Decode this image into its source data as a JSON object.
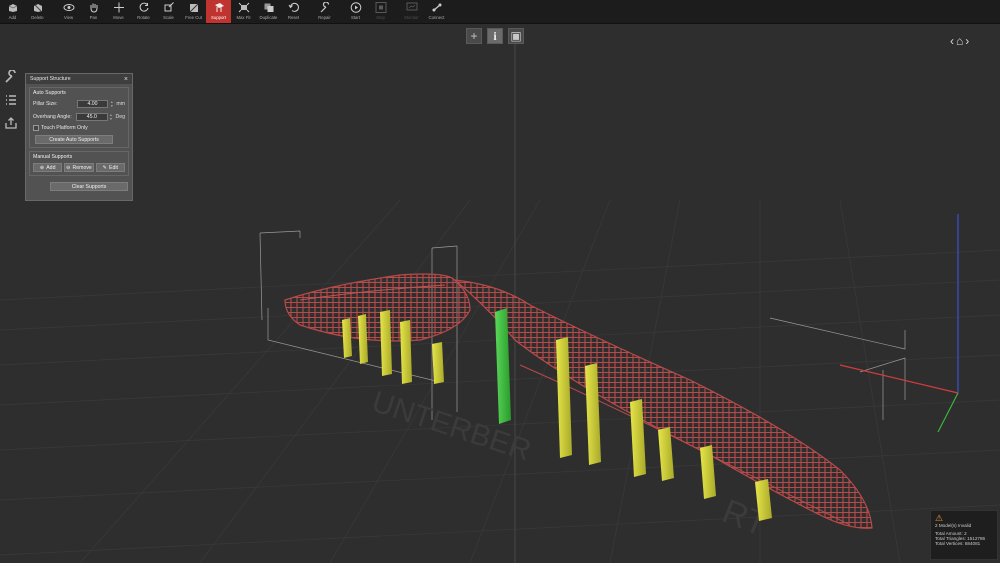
{
  "toolbar": {
    "items": [
      {
        "label": "Add",
        "icon": "add-model-icon"
      },
      {
        "label": "Delete",
        "icon": "delete-icon"
      },
      {
        "label": "View",
        "icon": "eye-icon"
      },
      {
        "label": "Pan",
        "icon": "hand-icon"
      },
      {
        "label": "Move",
        "icon": "move-icon"
      },
      {
        "label": "Rotate",
        "icon": "rotate-icon"
      },
      {
        "label": "Scale",
        "icon": "scale-icon"
      },
      {
        "label": "Free Cut",
        "icon": "free-cut-icon"
      },
      {
        "label": "Support",
        "icon": "support-icon",
        "active": true
      },
      {
        "label": "Max Fit",
        "icon": "max-fit-icon"
      },
      {
        "label": "Duplicate",
        "icon": "duplicate-icon"
      },
      {
        "label": "Reset",
        "icon": "reset-icon"
      },
      {
        "label": "Repair",
        "icon": "wrench-icon"
      },
      {
        "label": "Start",
        "icon": "play-icon"
      },
      {
        "label": "Stop",
        "icon": "stop-icon",
        "disabled": true
      },
      {
        "label": "Monitor",
        "icon": "monitor-icon",
        "disabled": true
      },
      {
        "label": "Connect",
        "icon": "connect-icon"
      }
    ]
  },
  "panel": {
    "title": "Support Structure",
    "close": "×",
    "auto": {
      "title": "Auto Supports",
      "pillar_label": "Pillar Size:",
      "pillar_value": "4.00",
      "pillar_unit": "mm",
      "angle_label": "Overhang Angle:",
      "angle_value": "45.0",
      "angle_unit": "Deg",
      "touch_label": "Touch Platform Only",
      "create_label": "Create Auto Supports"
    },
    "manual": {
      "title": "Manual Supports",
      "add_label": "Add",
      "remove_label": "Remove",
      "edit_label": "Edit"
    },
    "clear_label": "Clear Supports"
  },
  "status": {
    "warning": "2 Model(s) Invalid",
    "amount": "Total Amount: 2",
    "triangles": "Total Triangles: 1512786",
    "vertices": "Total Vertices: 684081"
  },
  "colors": {
    "accent": "#c0342f",
    "support_yellow": "#d4d43a",
    "support_selected": "#3cc23c",
    "lattice_red": "#b84a4a"
  }
}
